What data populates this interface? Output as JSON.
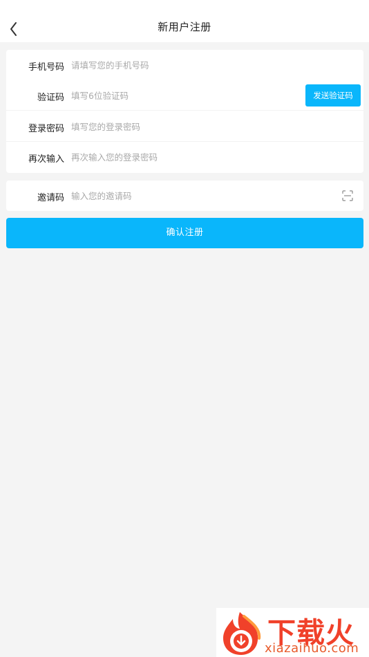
{
  "header": {
    "title": "新用户注册",
    "back_icon": "chevron-left-icon"
  },
  "form": {
    "phone": {
      "label": "手机号码",
      "placeholder": "请填写您的手机号码"
    },
    "code": {
      "label": "验证码",
      "placeholder": "填写6位验证码",
      "send_button": "发送验证码"
    },
    "password": {
      "label": "登录密码",
      "placeholder": "填写您的登录密码"
    },
    "confirm": {
      "label": "再次输入",
      "placeholder": "再次输入您的登录密码"
    },
    "invite": {
      "label": "邀请码",
      "placeholder": "输入您的邀请码",
      "scan_icon": "scan-icon"
    }
  },
  "submit": {
    "label": "确认注册"
  },
  "watermark": {
    "brand": "下载火",
    "url": "xiazaihuo.com"
  },
  "colors": {
    "accent": "#0ab6fb",
    "background": "#f4f4f4",
    "watermark": "#f0412a"
  }
}
